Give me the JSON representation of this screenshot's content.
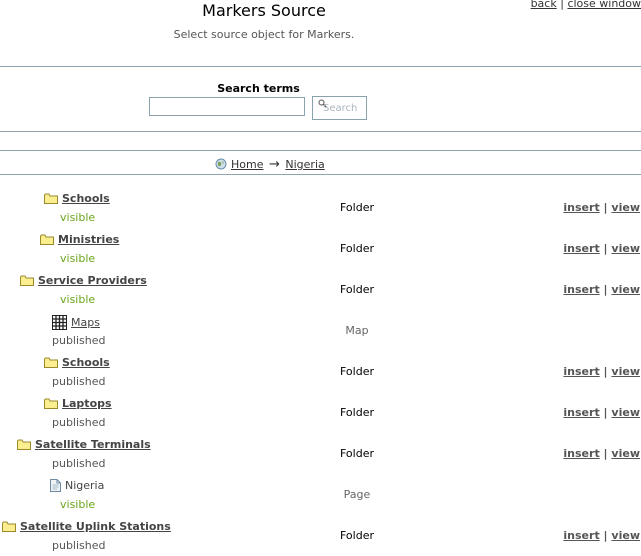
{
  "header": {
    "title": "Markers Source",
    "subtitle": "Select source object for Markers.",
    "back_label": "back",
    "separator": "|",
    "close_label": "close window"
  },
  "search": {
    "label": "Search terms",
    "value": "",
    "placeholder": "",
    "button_label": "Search"
  },
  "breadcrumb": {
    "home": "Home",
    "arrow": "→",
    "current": "Nigeria"
  },
  "items": [
    {
      "name": "Schools",
      "status": "visible",
      "type": "Folder",
      "insert": "insert",
      "sep": "|",
      "view": "view"
    },
    {
      "name": "Ministries",
      "status": "visible",
      "type": "Folder",
      "insert": "insert",
      "sep": "|",
      "view": "view"
    },
    {
      "name": "Service Providers",
      "status": "visible",
      "type": "Folder",
      "insert": "insert",
      "sep": "|",
      "view": "view"
    },
    {
      "name": "Maps",
      "status": "published",
      "type": "Map"
    },
    {
      "name": "Schools",
      "status": "published",
      "type": "Folder",
      "insert": "insert",
      "sep": "|",
      "view": "view"
    },
    {
      "name": "Laptops",
      "status": "published",
      "type": "Folder",
      "insert": "insert",
      "sep": "|",
      "view": "view"
    },
    {
      "name": "Satellite Terminals",
      "status": "published",
      "type": "Folder",
      "insert": "insert",
      "sep": "|",
      "view": "view"
    },
    {
      "name": "Nigeria",
      "status": "visible",
      "type": "Page"
    },
    {
      "name": "Satellite Uplink Stations",
      "status": "published",
      "type": "Folder",
      "insert": "insert",
      "sep": "|",
      "view": "view"
    }
  ],
  "icons": {
    "folder": "folder-icon",
    "map": "grid-map-icon",
    "page": "document-icon",
    "globe": "globe-icon",
    "search": "magnifier-icon"
  },
  "colors": {
    "visible_status": "#6aa51a",
    "rule": "#8ea4b0",
    "folder_fill": "#fbee8f",
    "folder_stroke": "#9a8a2c"
  }
}
